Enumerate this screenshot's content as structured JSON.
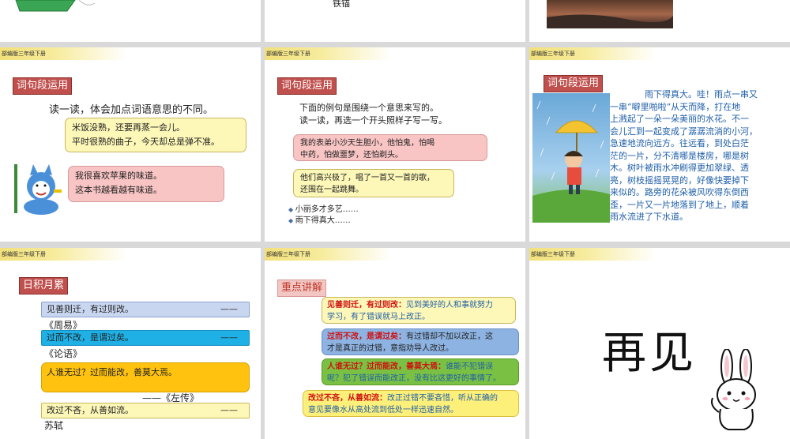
{
  "header_label": "部编版三年级下册",
  "top_row": {
    "fragment_text": "铁锚"
  },
  "slide4": {
    "tag": "词句段运用",
    "instruction": "读一读，体会加点词语意思的不同。",
    "box1_line1": "米饭没熟，还要再蒸一会儿。",
    "box1_line2": "平时很熟的曲子，今天却总是弹不准。",
    "box2_line1": "我很喜欢苹果的味道。",
    "box2_line2": "这本书越看越有味道。"
  },
  "slide5": {
    "tag": "词句段运用",
    "instruction1": "下面的例句是围绕一个意思来写的。",
    "instruction2": "读一读，再选一个开头照样子写一写。",
    "example1_line1": "我的表弟小沙天生胆小，他怕鬼，怕喝",
    "example1_line2": "中药，怕做噩梦，还怕剃头。",
    "example2_line1": "他们高兴极了，唱了一首又一首的歌，",
    "example2_line2": "还围在一起跳舞。",
    "option1": "小丽多才多艺……",
    "option2": "雨下得真大……"
  },
  "slide6": {
    "tag": "词句段运用",
    "paragraph": [
      "雨下得真大。哇！雨点一串又",
      "一串“噼里啪啦”从天而降，打在地",
      "上溅起了一朵一朵美丽的水花。不一",
      "会儿汇到一起变成了潺潺流淌的小河，",
      "急速地流向远方。往远看，到处白茫",
      "茫的一片，分不清哪是楼房，哪是树",
      "木。树叶被雨水冲刷得更加翠绿、透",
      "亮，树枝摇摇晃晃的，好像快要掉下",
      "来似的。路旁的花朵被风吹得东倒西",
      "歪，一片又一片地落到了地上，顺着",
      "雨水流进了下水道。"
    ]
  },
  "slide7": {
    "tag": "日积月累",
    "quote1": "见善则迁，有过则改。",
    "dash1": "——",
    "source1": "《周易》",
    "quote2": "过而不改，是谓过矣。",
    "dash2": "——",
    "source2": "《论语》",
    "quote3": "人谁无过？过而能改，善莫大焉。",
    "source3": "——《左传》",
    "quote4": "改过不吝，从善如流。",
    "dash4": "——",
    "source4": "苏轼"
  },
  "slide8": {
    "tag": "重点讲解",
    "item1_head": "见善则迁，有过则改：",
    "item1_body1": "见到美好的人和事就努力",
    "item1_body2": "学习，有了错误就马上改正。",
    "item2_head": "过而不改，是谓过矣：",
    "item2_body1": "有过错却不加以改正，这",
    "item2_body2": "才是真正的过错，意指劝导人改过。",
    "item3_head": "人谁无过？过而能改，善莫大焉：",
    "item3_body1": "谁能不犯错误",
    "item3_body2": "呢？犯了错误而能改正，没有比这更好的事情了。",
    "item4_head": "改过不吝，从善如流：",
    "item4_body1": "改正过错不要吝惜，听从正确的",
    "item4_body2": "意见要像水从高处流到低处一样迅速自然。"
  },
  "slide9": {
    "farewell": "再见"
  }
}
